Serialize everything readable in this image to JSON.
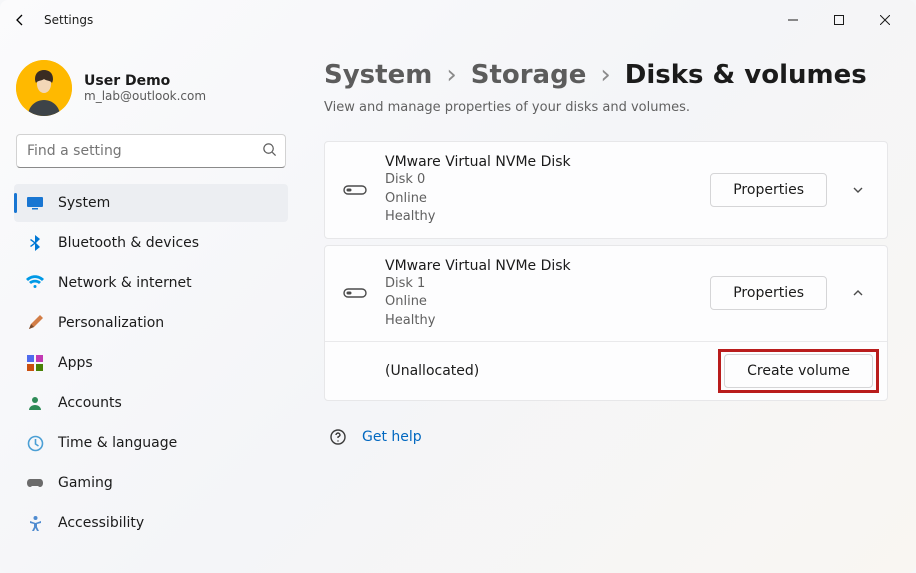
{
  "window": {
    "title": "Settings"
  },
  "profile": {
    "name": "User Demo",
    "email": "m_lab@outlook.com"
  },
  "search": {
    "placeholder": "Find a setting"
  },
  "sidebar": {
    "items": [
      {
        "label": "System"
      },
      {
        "label": "Bluetooth & devices"
      },
      {
        "label": "Network & internet"
      },
      {
        "label": "Personalization"
      },
      {
        "label": "Apps"
      },
      {
        "label": "Accounts"
      },
      {
        "label": "Time & language"
      },
      {
        "label": "Gaming"
      },
      {
        "label": "Accessibility"
      }
    ]
  },
  "breadcrumb": {
    "items": [
      "System",
      "Storage",
      "Disks & volumes"
    ]
  },
  "subtitle": "View and manage properties of your disks and volumes.",
  "disks": [
    {
      "name": "VMware Virtual NVMe Disk",
      "id": "Disk 0",
      "status": "Online",
      "health": "Healthy",
      "button": "Properties",
      "expanded": false
    },
    {
      "name": "VMware Virtual NVMe Disk",
      "id": "Disk 1",
      "status": "Online",
      "health": "Healthy",
      "button": "Properties",
      "expanded": true,
      "volume": {
        "label": "(Unallocated)",
        "button": "Create volume"
      }
    }
  ],
  "help": {
    "label": "Get help"
  }
}
